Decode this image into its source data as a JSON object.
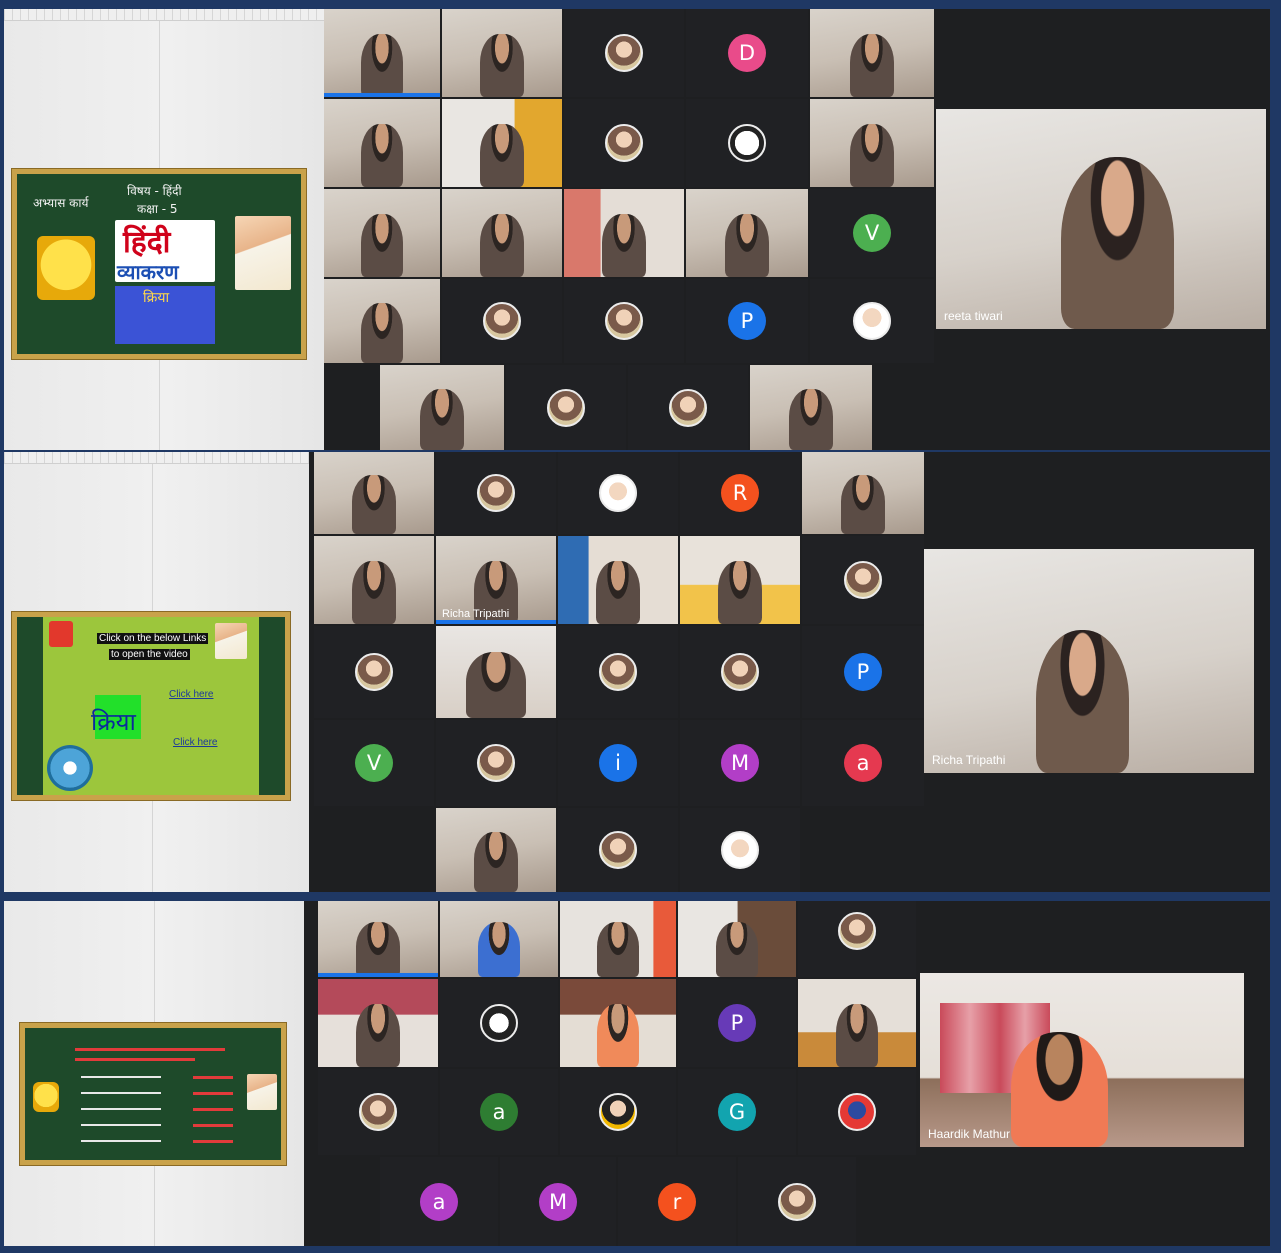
{
  "colors": {
    "frame": "#1f3864",
    "tile_bg": "#202124",
    "active_speaker": "#1a73e8",
    "avatar_green": "#4caf50",
    "avatar_pink": "#e94b8a",
    "avatar_blue": "#1a73e8",
    "avatar_purple": "#9c27b0",
    "avatar_orange": "#f4511e",
    "avatar_red": "#e53935",
    "avatar_teal": "#12a4af",
    "avatar_darkgreen": "#2e7d32"
  },
  "panels": [
    {
      "slide": {
        "lines": [
          "अभ्यास कार्य",
          "विषय - हिंदी",
          "कक्षा - 5",
          "हिंदी",
          "व्याकरण",
          "क्रिया"
        ]
      },
      "featured_name": "reeta tiwari",
      "avatars": [
        "D",
        "V",
        "P"
      ]
    },
    {
      "slide": {
        "lines": [
          "Click on the below Links",
          "to open the video",
          "क्रिया",
          "Click here",
          "Click here"
        ]
      },
      "featured_name": "Richa Tripathi",
      "tile_name": "Richa Tripathi",
      "avatars": [
        "R",
        "P",
        "V",
        "i",
        "M",
        "a"
      ]
    },
    {
      "slide": {
        "lines": []
      },
      "featured_name": "Haardik Mathur",
      "avatars": [
        "P",
        "a",
        "G",
        "a",
        "M",
        "r"
      ]
    }
  ]
}
